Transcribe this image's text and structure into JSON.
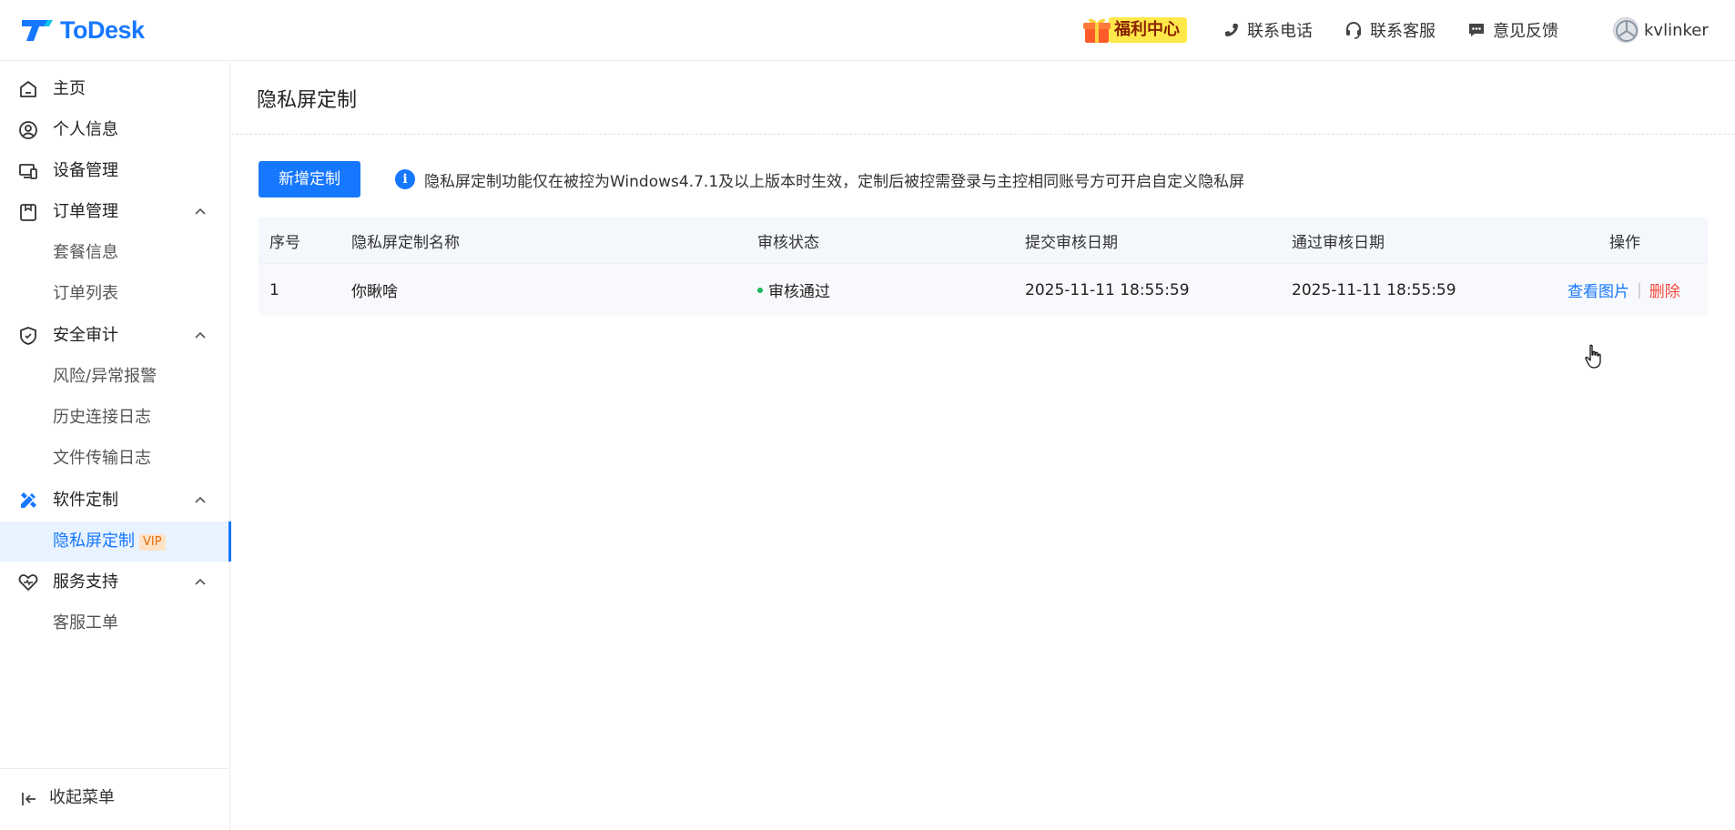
{
  "app": {
    "brand": "ToDesk",
    "brand_color": "#1677ff"
  },
  "topbar": {
    "welfare_label": "福利中心",
    "phone_label": "联系电话",
    "service_label": "联系客服",
    "feedback_label": "意见反馈",
    "username": "kvlinker"
  },
  "sidebar": {
    "home": "主页",
    "profile": "个人信息",
    "devices": "设备管理",
    "orders": "订单管理",
    "orders_sub": [
      "套餐信息",
      "订单列表"
    ],
    "security": "安全审计",
    "security_sub": [
      "风险/异常报警",
      "历史连接日志",
      "文件传输日志"
    ],
    "custom": "软件定制",
    "custom_sub_active": "隐私屏定制",
    "vip": "VIP",
    "support": "服务支持",
    "support_sub": [
      "客服工单"
    ],
    "collapse": "收起菜单"
  },
  "main": {
    "title": "隐私屏定制",
    "add_button": "新增定制",
    "notice": "隐私屏定制功能仅在被控为Windows4.7.1及以上版本时生效，定制后被控需登录与主控相同账号方可开启自定义隐私屏",
    "table": {
      "headers": [
        "序号",
        "隐私屏定制名称",
        "审核状态",
        "提交审核日期",
        "通过审核日期",
        "操作"
      ],
      "rows": [
        {
          "index": "1",
          "name": "你瞅啥",
          "status": "审核通过",
          "submit_date": "2025-11-11 18:55:59",
          "approve_date": "2025-11-11 18:55:59",
          "action_view": "查看图片",
          "action_sep": "|",
          "action_delete": "删除"
        }
      ]
    }
  },
  "colors": {
    "primary": "#1677ff",
    "success": "#18b85c",
    "danger": "#f5483b",
    "vip_bg": "#ffe2c6",
    "vip_text": "#e1700f"
  }
}
